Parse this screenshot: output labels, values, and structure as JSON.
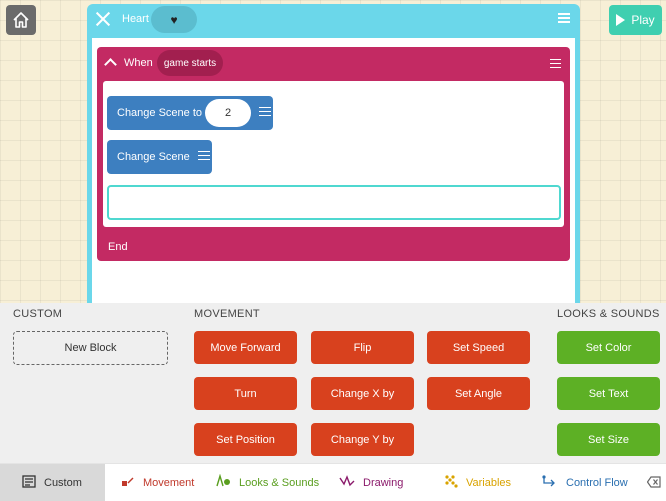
{
  "editor": {
    "character_name": "Heart",
    "character_icon": "♥",
    "rule": {
      "when_label": "When",
      "event": "game starts",
      "blocks": [
        {
          "label": "Change Scene to",
          "value": "2"
        },
        {
          "label": "Change Scene"
        }
      ],
      "end_label": "End"
    }
  },
  "play_label": "Play",
  "palette": {
    "custom": {
      "title": "CUSTOM",
      "new_block": "New Block"
    },
    "movement": {
      "title": "MOVEMENT",
      "blocks": [
        "Move Forward",
        "Flip",
        "Set Speed",
        "Turn",
        "Change X by",
        "Set Angle",
        "Set Position",
        "Change Y by"
      ]
    },
    "looks": {
      "title": "LOOKS & SOUNDS",
      "blocks": [
        "Set Color",
        "Set Text",
        "Set Size"
      ]
    }
  },
  "tabs": [
    {
      "label": "Custom",
      "icon": "custom-icon",
      "color": "#333333"
    },
    {
      "label": "Movement",
      "icon": "movement-icon",
      "color": "#c0392b"
    },
    {
      "label": "Looks & Sounds",
      "icon": "looks-icon",
      "color": "#5a9e1f"
    },
    {
      "label": "Drawing",
      "icon": "drawing-icon",
      "color": "#8b1a6b"
    },
    {
      "label": "Variables",
      "icon": "variables-icon",
      "color": "#d9a300"
    },
    {
      "label": "Control Flow",
      "icon": "control-flow-icon",
      "color": "#2a6fb0"
    }
  ],
  "colors": {
    "editor": "#6bd7ea",
    "rule": "#c32a63",
    "code_block": "#3d7fc0",
    "movement_block": "#d8411e",
    "looks_block": "#5db025",
    "play": "#3fcfb0"
  }
}
